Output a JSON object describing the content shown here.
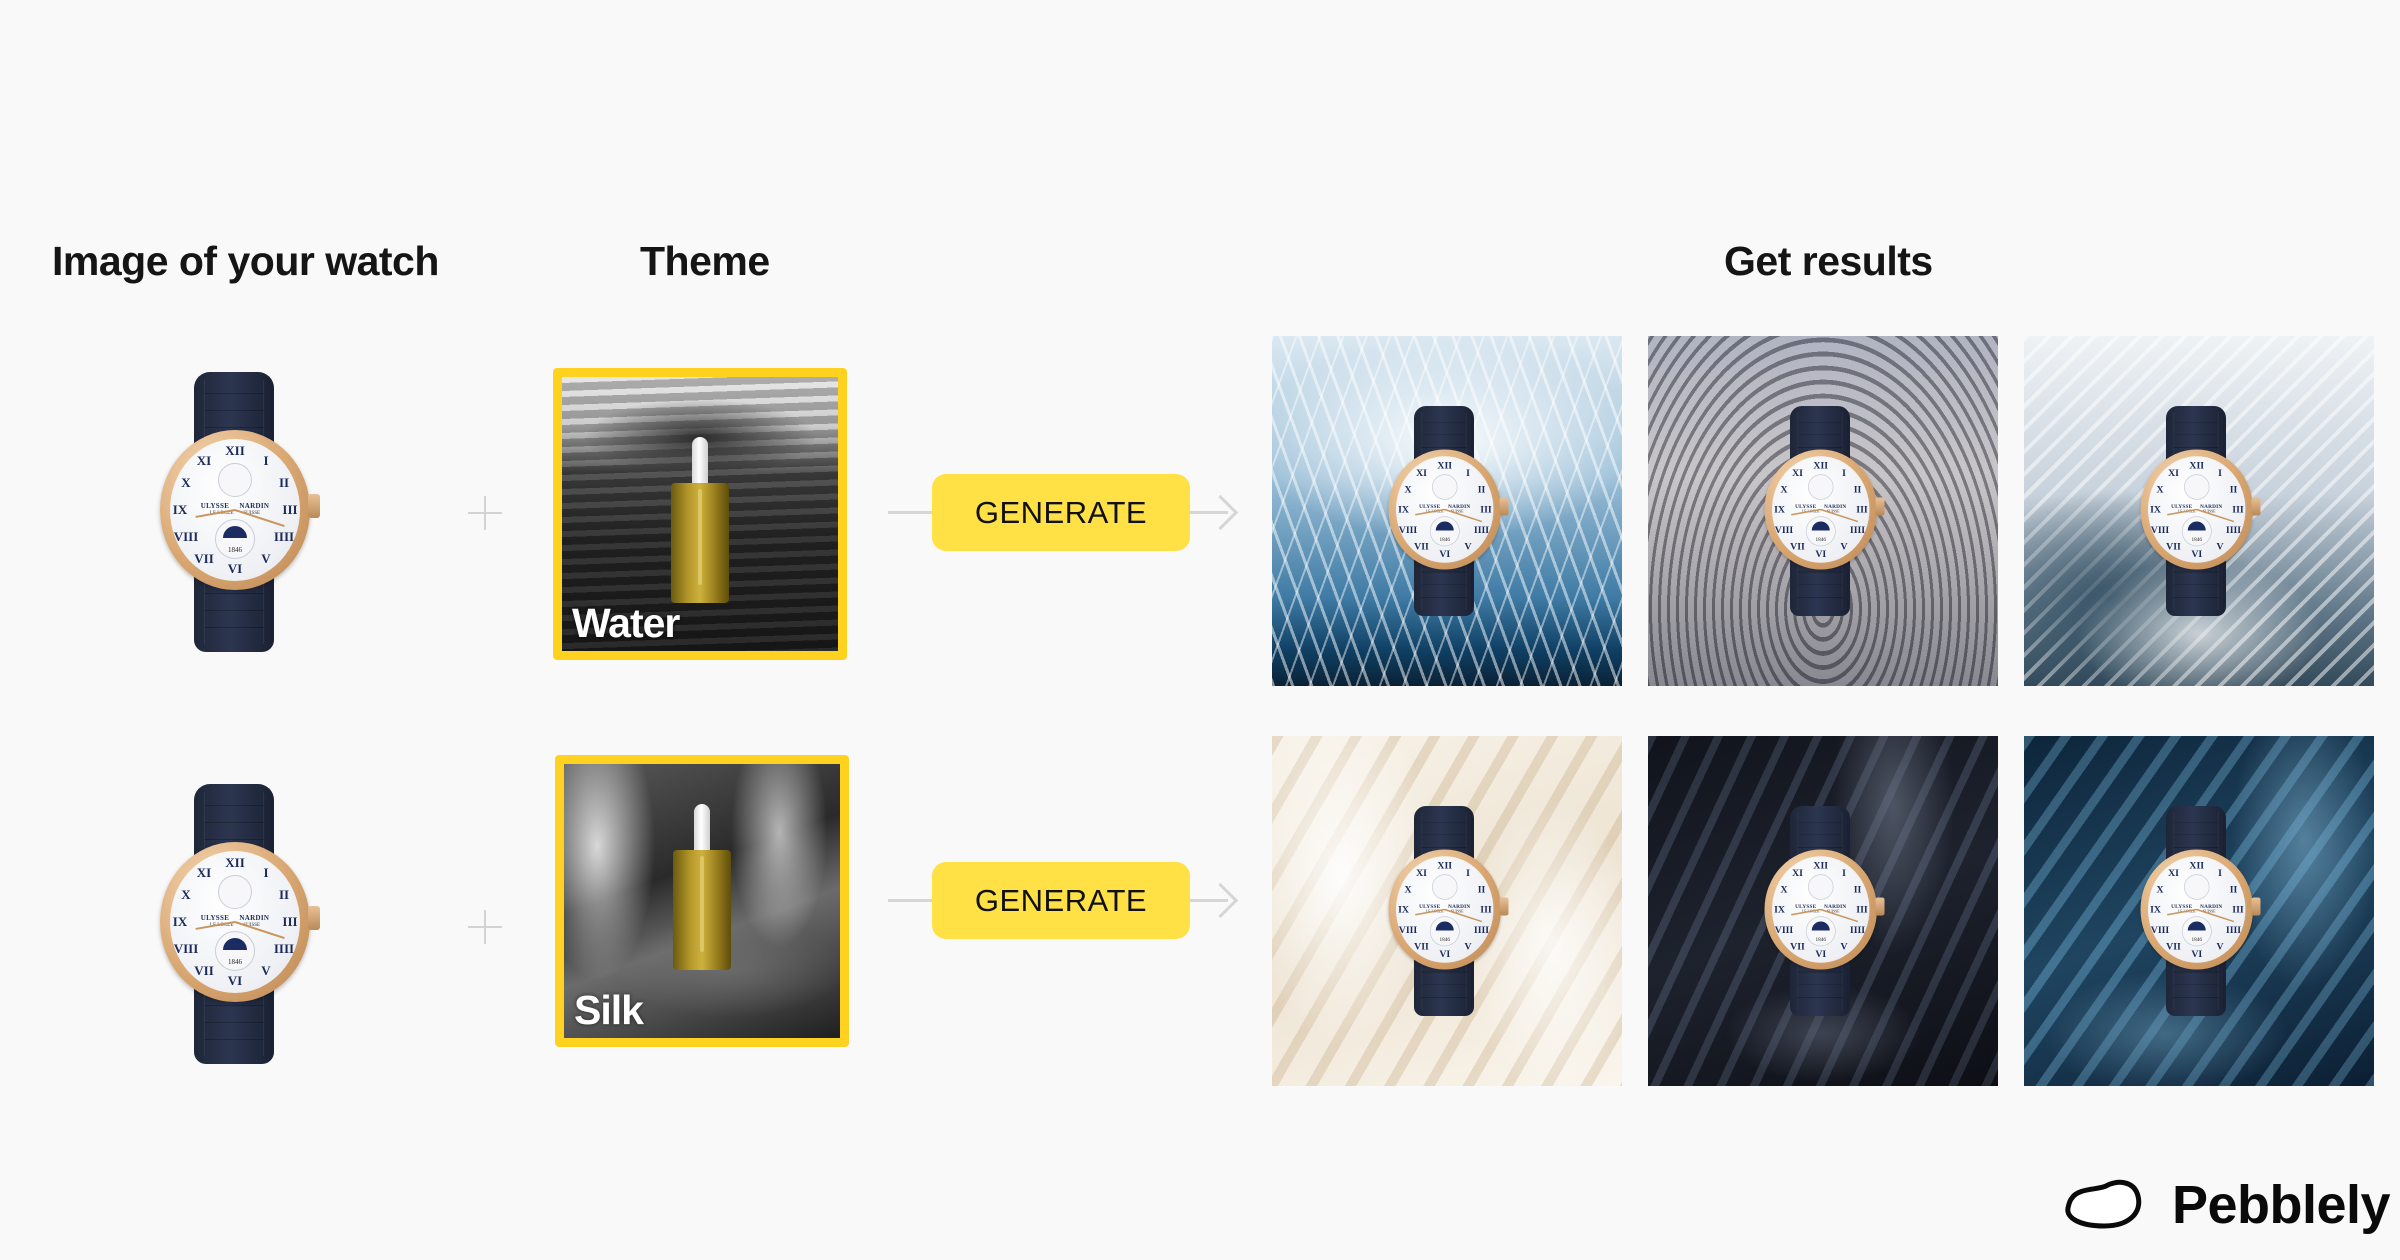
{
  "headers": {
    "input": "Image of your watch",
    "theme": "Theme",
    "results": "Get results"
  },
  "product": {
    "name": "watch",
    "dial_text": {
      "brand_left": "ULYSSE",
      "brand_right": "NARDIN",
      "sub_left": "LE LOCLE",
      "sub_right": "SUISSE",
      "year": "1846"
    }
  },
  "rows": [
    {
      "theme": {
        "label": "Water",
        "icon": "water-theme-thumbnail"
      },
      "button": {
        "label": "GENERATE"
      },
      "results": [
        {
          "name": "water-splash-result"
        },
        {
          "name": "water-ripple-result"
        },
        {
          "name": "water-wave-result"
        }
      ]
    },
    {
      "theme": {
        "label": "Silk",
        "icon": "silk-theme-thumbnail"
      },
      "button": {
        "label": "GENERATE"
      },
      "results": [
        {
          "name": "ivory-silk-result"
        },
        {
          "name": "black-silk-result"
        },
        {
          "name": "blue-silk-result"
        }
      ]
    }
  ],
  "colors": {
    "accent_yellow": "#ffe045",
    "theme_border": "#ffd21f",
    "connector": "#d6d6d6",
    "background": "#f9f9f9"
  },
  "brand": {
    "name": "Pebblely",
    "icon": "pebble-logo-icon"
  }
}
